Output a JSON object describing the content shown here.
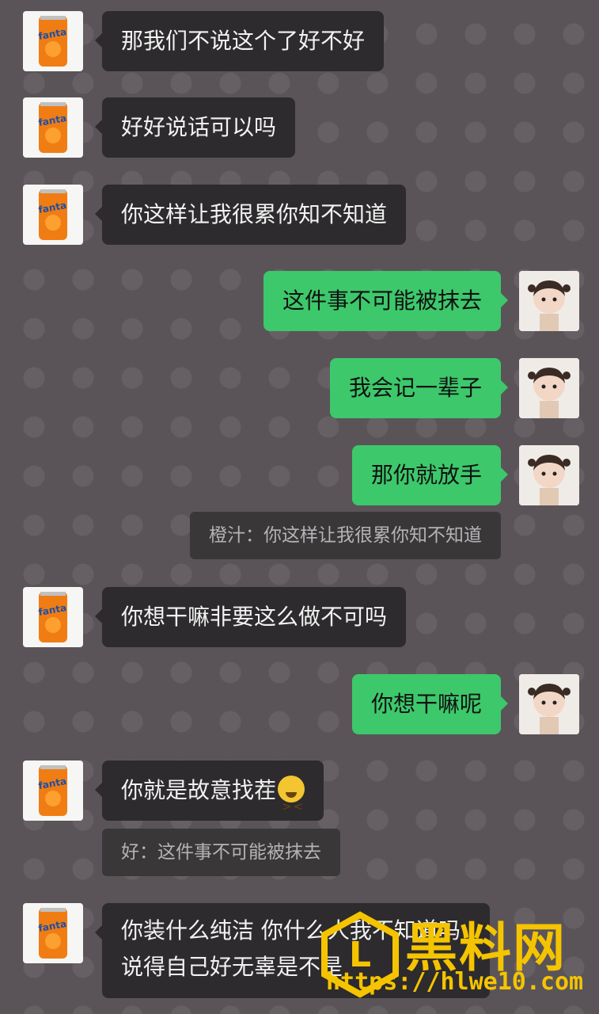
{
  "messages": [
    {
      "type": "in",
      "text": "那我们不说这个了好不好"
    },
    {
      "type": "in",
      "text": "好好说话可以吗"
    },
    {
      "type": "in",
      "text": "你这样让我很累你知不知道"
    },
    {
      "type": "out",
      "text": "这件事不可能被抹去"
    },
    {
      "type": "out",
      "text": "我会记一辈子"
    },
    {
      "type": "out",
      "text": "那你就放手"
    },
    {
      "type": "quote",
      "text": "橙汁：你这样让我很累你知不知道"
    },
    {
      "type": "in",
      "text": "你想干嘛非要这么做不可吗"
    },
    {
      "type": "out",
      "text": "你想干嘛呢"
    },
    {
      "type": "in",
      "text": "你就是故意找茬",
      "emoji": "squint-crying-emoji"
    },
    {
      "type": "quote",
      "text": "好：这件事不可能被抹去"
    },
    {
      "type": "in",
      "text": "你装什么纯洁 你什么人我不知道吗 说得自己好无辜是不是"
    }
  ],
  "watermark": {
    "text": "黑料网",
    "url": "https://hlwe10.com"
  },
  "colors": {
    "incoming_bubble": "#2d2b2d",
    "outgoing_bubble": "#3dc86b",
    "background": "#5a5459",
    "watermark": "#f5c400"
  }
}
